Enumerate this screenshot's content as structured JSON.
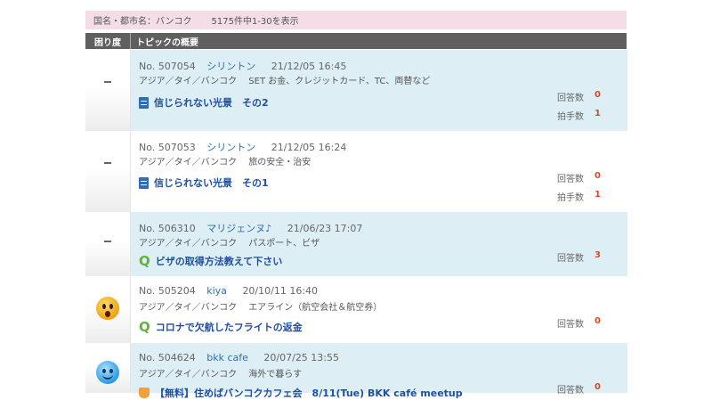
{
  "summary": {
    "location": "国名・都市名：バンコク",
    "count": "5175件中1-30を表示"
  },
  "table_header": {
    "col1": "困り度",
    "col2": "トピックの概要"
  },
  "labels": {
    "replies": "回答数",
    "applause": "拍手数"
  },
  "topics": [
    {
      "no": "No. 507054",
      "user": "シリントン",
      "date": "21/12/05 16:45",
      "category": "アジア／タイ／バンコク",
      "tag": "SET お金、クレジットカード、TC、両替など",
      "title": "信じられない光景　その2",
      "replies": "0",
      "applause": "1",
      "icon": "document-icon",
      "trouble": "none"
    },
    {
      "no": "No. 507053",
      "user": "シリントン",
      "date": "21/12/05 16:24",
      "category": "アジア／タイ／バンコク",
      "tag": "旅の安全・治安",
      "title": "信じられない光景　その1",
      "replies": "0",
      "applause": "1",
      "icon": "document-icon",
      "trouble": "none"
    },
    {
      "no": "No. 506310",
      "user": "マリジェンヌ♪",
      "date": "21/06/23 17:07",
      "category": "アジア／タイ／バンコク",
      "tag": "パスポート、ビザ",
      "title": "ビザの取得方法教えて下さい",
      "replies": "3",
      "icon": "question-icon",
      "trouble": "none"
    },
    {
      "no": "No. 505204",
      "user": "kiya",
      "date": "20/10/11 16:40",
      "category": "アジア／タイ／バンコク",
      "tag": "エアライン（航空会社＆航空券）",
      "title": "コロナで欠航したフライトの返金",
      "replies": "0",
      "icon": "question-icon",
      "trouble": "surprised-face"
    },
    {
      "no": "No. 504624",
      "user": "bkk cafe",
      "date": "20/07/25 13:55",
      "category": "アジア／タイ／バンコク",
      "tag": "海外で暮らす",
      "title": "【無料】住めばバンコクカフェ会　8/11(Tue) BKK café meetup",
      "replies": "0",
      "icon": "hand-icon",
      "trouble": "smiling-face"
    }
  ]
}
